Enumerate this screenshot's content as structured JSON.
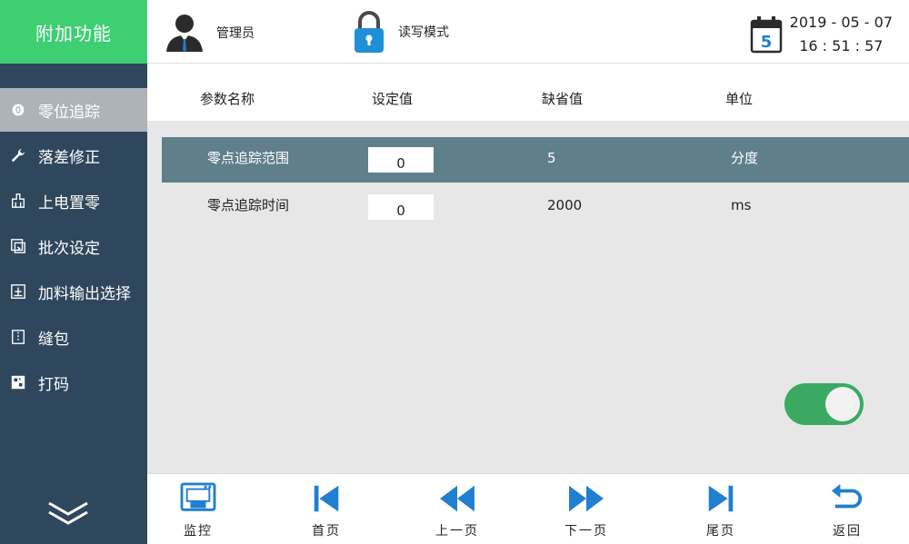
{
  "app": {
    "title": "附加功能"
  },
  "header": {
    "user_label": "管理员",
    "mode_label": "读写模式",
    "calendar_day": "5",
    "date": "2019 - 05 - 07",
    "time": "16 : 51 : 57"
  },
  "sidebar": {
    "items": [
      {
        "label": "零位追踪",
        "icon": "zero-track-icon",
        "active": true
      },
      {
        "label": "落差修正",
        "icon": "wrench-icon"
      },
      {
        "label": "上电置零",
        "icon": "power-zero-icon"
      },
      {
        "label": "批次设定",
        "icon": "batch-icon"
      },
      {
        "label": "加料输出选择",
        "icon": "feed-output-icon"
      },
      {
        "label": "缝包",
        "icon": "sewing-icon"
      },
      {
        "label": "打码",
        "icon": "print-code-icon"
      }
    ]
  },
  "table": {
    "headers": [
      "参数名称",
      "设定值",
      "缺省值",
      "单位"
    ],
    "rows": [
      {
        "name": "零点追踪范围",
        "value": "0",
        "default": "5",
        "unit": "分度"
      },
      {
        "name": "零点追踪时间",
        "value": "0",
        "default": "2000",
        "unit": "ms"
      }
    ]
  },
  "toggle": {
    "on": true
  },
  "toolbar": {
    "monitor": "监控",
    "first": "首页",
    "prev": "上一页",
    "next": "下一页",
    "last": "尾页",
    "back": "返回"
  },
  "colors": {
    "accent_green": "#3ecf72",
    "sidebar_bg": "#2f475d",
    "row_highlight": "#5f7f8b",
    "icon_blue": "#1f7fd0",
    "toggle_green": "#3aaa63"
  }
}
